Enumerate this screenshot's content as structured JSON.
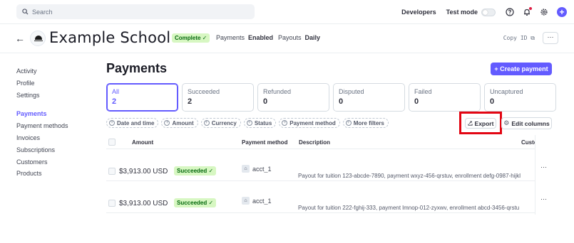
{
  "topbar": {
    "search_placeholder": "Search",
    "developers": "Developers",
    "test_mode": "Test mode"
  },
  "header": {
    "school_name": "Example School",
    "status_badge": "Complete ✓",
    "payments_label": "Payments",
    "payments_value": "Enabled",
    "payouts_label": "Payouts",
    "payouts_value": "Daily",
    "copy_id": "Copy ID",
    "more": "···"
  },
  "sidebar": {
    "items_top": [
      "Activity",
      "Profile",
      "Settings"
    ],
    "items_bottom": [
      "Payments",
      "Payment methods",
      "Invoices",
      "Subscriptions",
      "Customers",
      "Products"
    ],
    "active": "Payments"
  },
  "main": {
    "title": "Payments",
    "create_button": "+ Create payment",
    "tabs": [
      {
        "label": "All",
        "count": "2"
      },
      {
        "label": "Succeeded",
        "count": "2"
      },
      {
        "label": "Refunded",
        "count": "0"
      },
      {
        "label": "Disputed",
        "count": "0"
      },
      {
        "label": "Failed",
        "count": "0"
      },
      {
        "label": "Uncaptured",
        "count": "0"
      }
    ],
    "filters": [
      "Date and time",
      "Amount",
      "Currency",
      "Status",
      "Payment method",
      "More filters"
    ],
    "export_button": "Export",
    "edit_columns_button": "Edit columns"
  },
  "table": {
    "columns": [
      "Amount",
      "Payment method",
      "Description",
      "Custo"
    ],
    "rows": [
      {
        "amount": "$3,913.00 USD",
        "status": "Succeeded ✓",
        "payment_method": "acct_1I",
        "description": "Payout for tuition 123-abcde-7890, payment wxyz-456-qrstuv, enrollment defg-0987-hijkl"
      },
      {
        "amount": "$3,913.00 USD",
        "status": "Succeeded ✓",
        "payment_method": "acct_1I",
        "description": "Payout for tuition 222-fghij-333, payment lmnop-012-zyxwv, enrollment abcd-3456-qrstu"
      }
    ]
  },
  "colors": {
    "accent": "#635bff",
    "success_bg": "#d7f7c2",
    "success_text": "#05690d",
    "highlight": "#e30613"
  }
}
